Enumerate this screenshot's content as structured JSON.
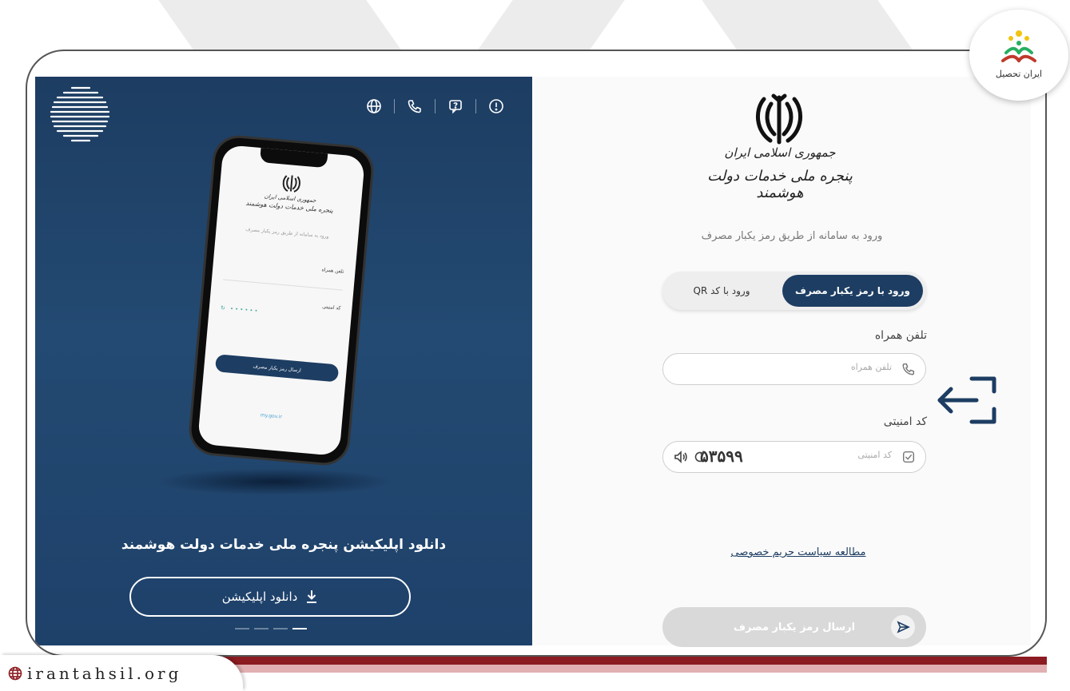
{
  "left_panel": {
    "top_icons": [
      "globe-icon",
      "phone-icon",
      "help-chat-icon",
      "info-icon"
    ],
    "phone_mock": {
      "header_line1": "جمهوری اسلامی ایران",
      "header_line2": "پنجره ملی خدمات دولت هوشمند",
      "subtitle": "ورود به سامانه از طریق رمز یکبار مصرف",
      "phone_label": "تلفن همراه",
      "code_label": "کد امنیتی",
      "send_button": "ارسال رمز یکبار مصرف",
      "footer": "my.gov.ir"
    },
    "download_title": "دانلود اپلیکیشن پنجره ملی خدمات دولت هوشمند",
    "download_button": "دانلود اپلیکیشن"
  },
  "right_panel": {
    "emblem_line1": "جمهوری اسلامی ایران",
    "emblem_line2": "پنجره ملی خدمات دولت هوشمند",
    "subtitle": "ورود به سامانه از طریق رمز یکبار مصرف",
    "tabs": {
      "otp": "ورود با رمز یکبار مصرف",
      "qr": "ورود با کد QR"
    },
    "phone_field": {
      "label": "تلفن همراه",
      "placeholder": "تلفن همراه"
    },
    "security_field": {
      "label": "کد امنیتی",
      "placeholder": "کد امنیتی",
      "captcha": "۵۳۵۹۹"
    },
    "privacy_link": "مطالعه سیاست حریم خصوصی",
    "send_button": "ارسال رمز یکبار مصرف"
  },
  "brand": {
    "name": "ایران تحصیل",
    "watermark": "irantahsil.org"
  },
  "colors": {
    "primary": "#1d3d62",
    "accent": "#8c1c22",
    "disabled": "#d9d9d9"
  }
}
